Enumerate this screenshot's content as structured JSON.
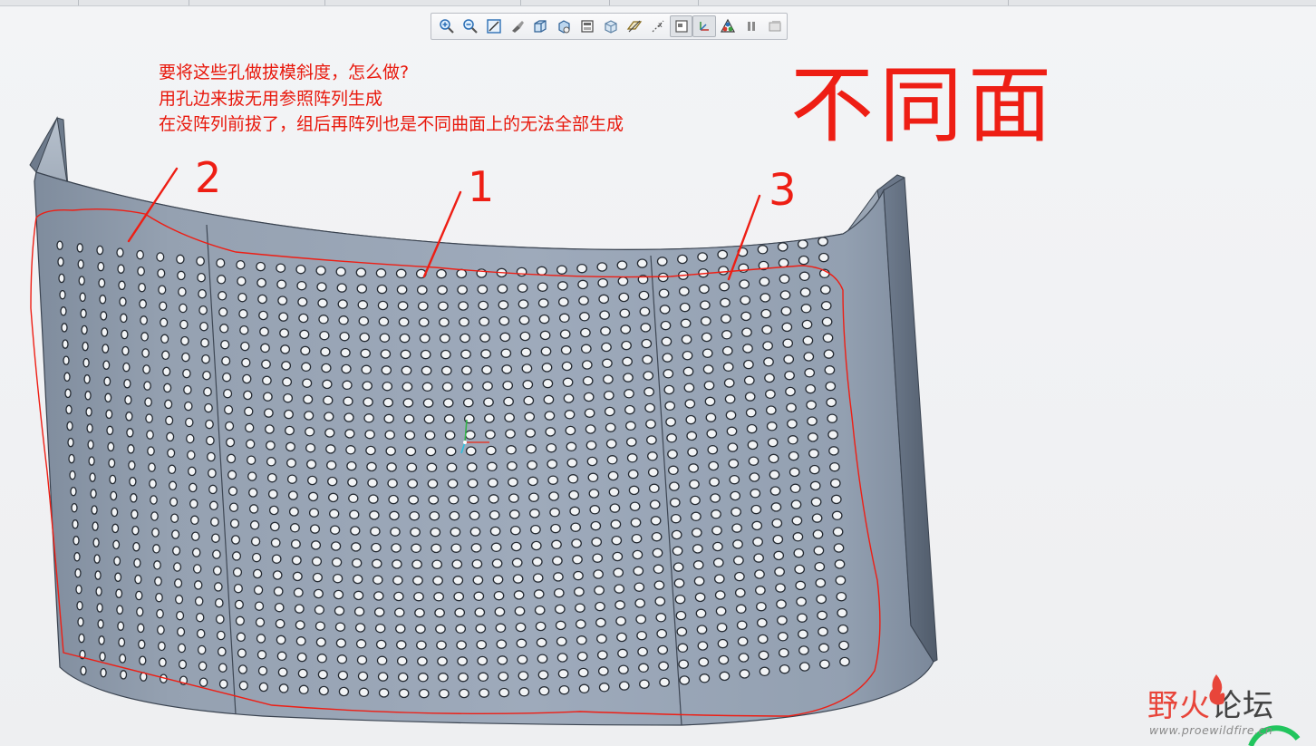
{
  "toolbar": {
    "icons": [
      "zoom-in-icon",
      "zoom-out-icon",
      "refit-icon",
      "repaint-icon",
      "shading-icon",
      "view-manager-icon",
      "saved-views-icon",
      "display-style-icon",
      "datum-plane-icon",
      "datum-axis-icon",
      "datum-point-icon",
      "csys-icon",
      "annotation-icon",
      "pause-icon",
      "spin-center-icon"
    ]
  },
  "annotation": {
    "line1": "要将这些孔做拔模斜度，怎么做?",
    "line2": "用孔边来拔无用参照阵列生成",
    "line3": "在没阵列前拔了，组后再阵列也是不同曲面上的无法全部生成"
  },
  "handwriting": {
    "label_1": "1",
    "label_2": "2",
    "label_3": "3",
    "big_title": "不同面"
  },
  "watermark": {
    "brand_red": "野火",
    "brand_gray": "论坛",
    "url": "www.proewildfire.cn"
  },
  "colors": {
    "annotation_red": "#e8180c",
    "part_body": "#8a97a8",
    "part_face": "#9aa6b6"
  }
}
